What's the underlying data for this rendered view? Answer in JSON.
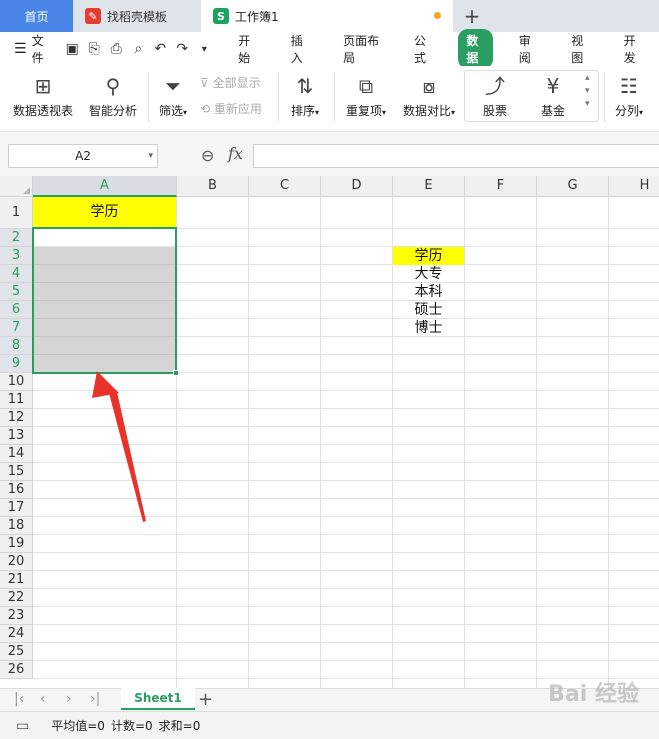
{
  "tabs": {
    "home": "首页",
    "templates": "找稻壳模板",
    "workbook": "工作簿1",
    "add": "+"
  },
  "menu": {
    "file": "文件",
    "items": [
      "开始",
      "插入",
      "页面布局",
      "公式",
      "数据",
      "审阅",
      "视图",
      "开发"
    ],
    "active": "数据"
  },
  "ribbon": {
    "pivot": "数据透视表",
    "smart": "智能分析",
    "filter": "筛选",
    "show_all": "全部显示",
    "reapply": "重新应用",
    "sort": "排序",
    "duplicates": "重复项",
    "compare": "数据对比",
    "stock": "股票",
    "fund": "基金",
    "split": "分列"
  },
  "formula_bar": {
    "name_box": "A2",
    "fx": "fx",
    "value": ""
  },
  "grid": {
    "columns": [
      "A",
      "B",
      "C",
      "D",
      "E",
      "F",
      "G",
      "H"
    ],
    "selected_column": "A",
    "rows": [
      "1",
      "2",
      "3",
      "4",
      "5",
      "6",
      "7",
      "8",
      "9",
      "10",
      "11",
      "12",
      "13",
      "14",
      "15",
      "16",
      "17",
      "18",
      "19",
      "20",
      "21",
      "22",
      "23",
      "24",
      "25",
      "26"
    ],
    "a1": "学历",
    "e_list": [
      "学历",
      "大专",
      "本科",
      "硕士",
      "博士"
    ]
  },
  "sheets": {
    "active": "Sheet1",
    "add": "+"
  },
  "status": {
    "avg": "平均值=0",
    "count": "计数=0",
    "sum": "求和=0"
  },
  "watermark": "Bai 经验",
  "colors": {
    "accent": "#2a9d62",
    "home_tab": "#4a86e8",
    "highlight": "#ffff00",
    "arrow": "#e8322a"
  }
}
